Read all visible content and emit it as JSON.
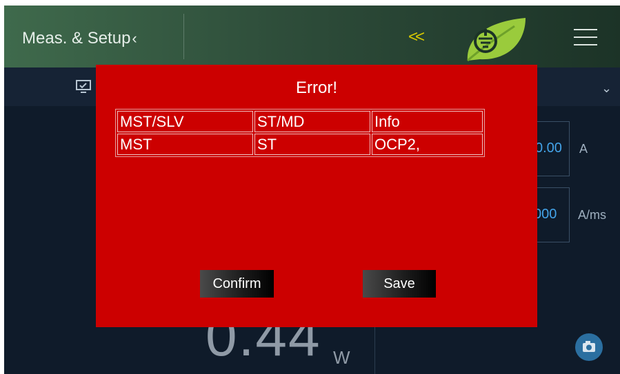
{
  "header": {
    "title": "Meas. & Setup",
    "title_chevron": "‹",
    "collapse_chevron": "<<"
  },
  "background": {
    "current_value": "0.00",
    "current_unit": "A",
    "slew_value": "000",
    "slew_unit": "A/ms",
    "power_value": "0.44",
    "power_unit": "W"
  },
  "dialog": {
    "title": "Error!",
    "table": {
      "headers": [
        "MST/SLV",
        "ST/MD",
        "Info"
      ],
      "rows": [
        [
          "MST",
          "ST",
          "OCP2,"
        ]
      ]
    },
    "confirm_label": "Confirm",
    "save_label": "Save"
  },
  "colors": {
    "dialog_bg": "#cc0000",
    "header_green": "#3f6a4c",
    "accent_yellow": "#d8c800",
    "value_blue": "#43a3e8"
  },
  "icons": [
    "monitor-icon",
    "leaf-logo-icon",
    "menu-icon",
    "chevron-down-icon",
    "camera-icon"
  ]
}
